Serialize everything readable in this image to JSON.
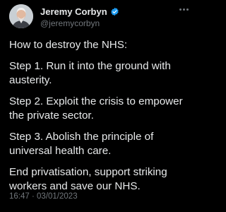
{
  "author": {
    "name": "Jeremy Corbyn",
    "handle": "@jeremycorbyn",
    "verified_color": "#1d9bf0"
  },
  "more_icon": "ellipsis-icon",
  "tweet": {
    "lines": [
      "How to destroy the NHS:",
      "Step 1. Run it into the ground with austerity.",
      "Step 2. Exploit the crisis to empower the private sector.",
      "Step 3. Abolish the principle of universal health care.",
      "End privatisation, support striking workers and save our NHS."
    ]
  },
  "meta": {
    "time": "16:47",
    "separator": "·",
    "date": "03/01/2023"
  }
}
